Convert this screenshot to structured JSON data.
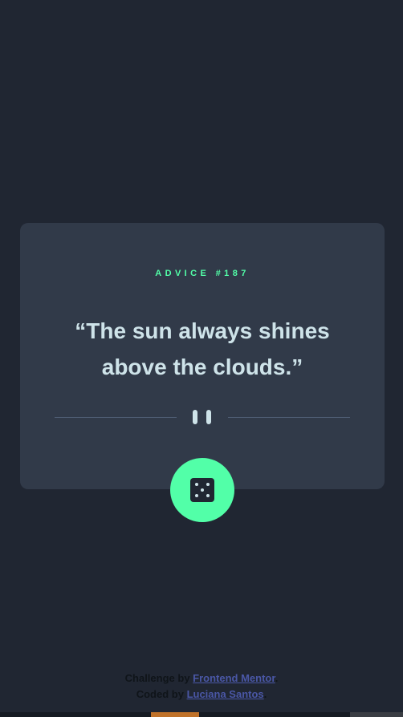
{
  "advice": {
    "label": "ADVICE #187",
    "quote": "“The sun always shines above the clouds.”"
  },
  "button": {
    "icon": "dice-icon"
  },
  "footer": {
    "challenge_prefix": "Challenge by ",
    "challenge_link": "Frontend Mentor",
    "challenge_suffix": ".",
    "coded_prefix": "Coded by ",
    "coded_link": "Luciana Santos",
    "coded_suffix": "."
  },
  "colors": {
    "background": "#202632",
    "card": "#313a49",
    "accent": "#52ffa8",
    "text": "#cee3e9",
    "divider": "#4f5d74",
    "link": "#4a57a6"
  }
}
